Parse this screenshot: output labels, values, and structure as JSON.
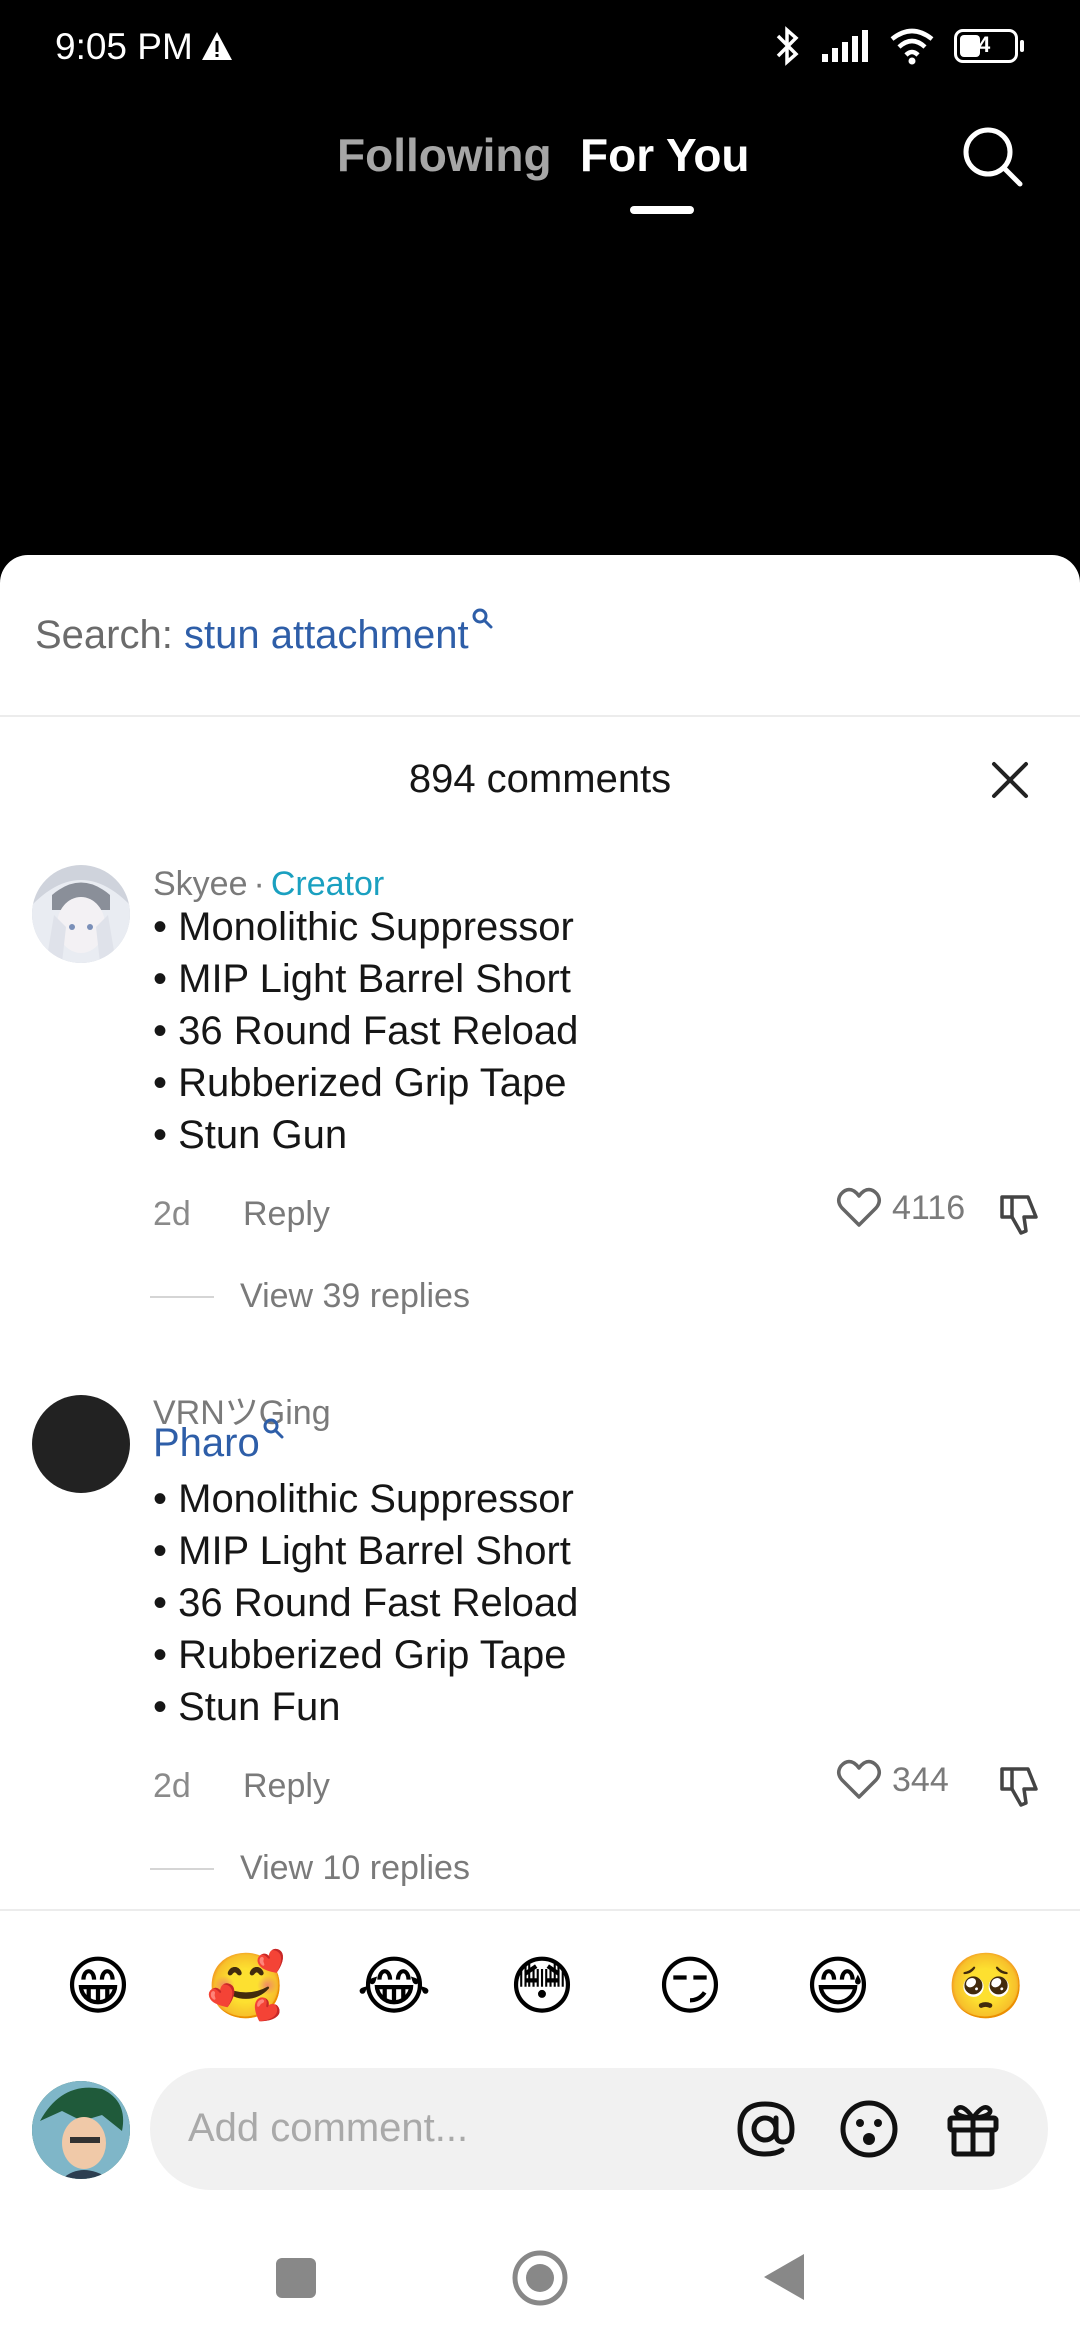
{
  "status": {
    "time": "9:05 PM",
    "battery": "4"
  },
  "nav": {
    "following": "Following",
    "for_you": "For You"
  },
  "search": {
    "prefix": "Search:",
    "term": "stun attachment"
  },
  "comments": {
    "count_label": "894 comments",
    "items": [
      {
        "user": "Skyee",
        "tag": "Creator",
        "lines": [
          "• Monolithic Suppressor",
          "• MIP Light Barrel Short",
          "• 36 Round Fast Reload",
          "• Rubberized Grip Tape",
          "• Stun Gun"
        ],
        "age": "2d",
        "reply": "Reply",
        "likes": "4116",
        "view_replies": "View 39 replies"
      },
      {
        "user": "VRNツGing",
        "mention": "Pharo",
        "lines": [
          "• Monolithic Suppressor",
          "• MIP Light Barrel Short",
          "• 36 Round Fast Reload",
          "• Rubberized Grip Tape",
          "• Stun Fun"
        ],
        "age": "2d",
        "reply": "Reply",
        "likes": "344",
        "view_replies": "View 10 replies"
      }
    ]
  },
  "emojis": [
    "😁",
    "🥰",
    "😂",
    "😳",
    "😏",
    "😅",
    "🥺"
  ],
  "input": {
    "placeholder": "Add comment..."
  },
  "colors": {
    "link_blue": "#2e5ea8",
    "creator_teal": "#1aa0c0"
  },
  "icons": [
    "warning-icon",
    "bluetooth-icon",
    "signal-icon",
    "wifi-icon",
    "battery-icon",
    "search-icon",
    "close-icon",
    "heart-icon",
    "thumbs-down-icon",
    "at-icon",
    "emoji-icon",
    "gift-icon"
  ]
}
